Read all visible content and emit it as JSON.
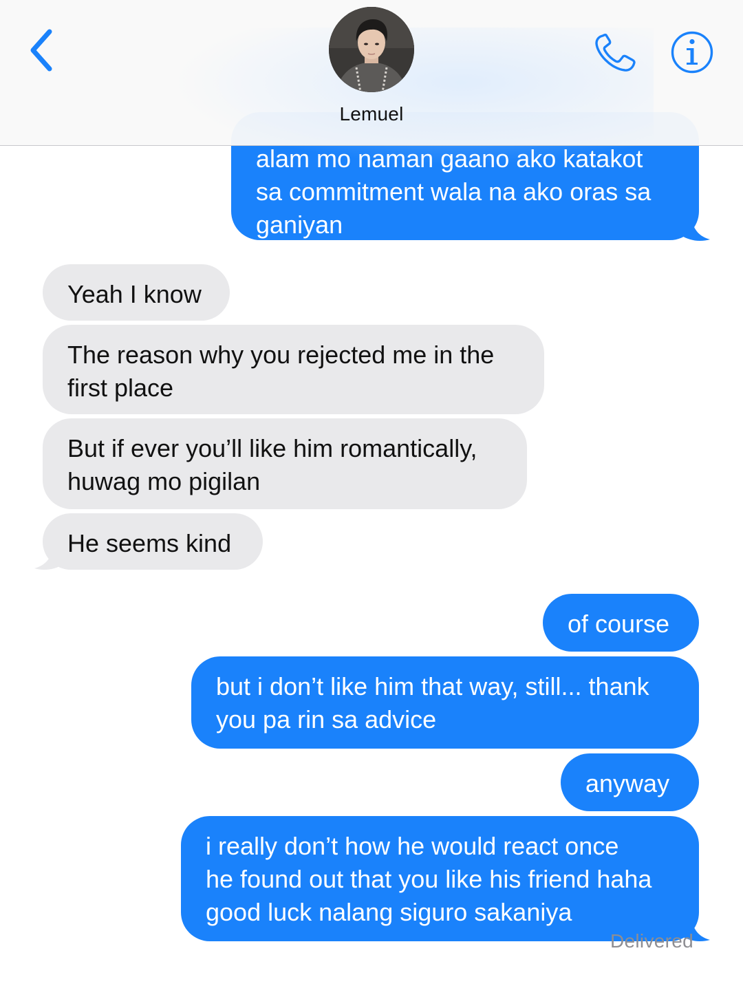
{
  "header": {
    "contact_name": "Lemuel",
    "back_icon": "chevron-left-icon",
    "call_icon": "phone-icon",
    "info_icon": "info-icon",
    "accent_color": "#1a82fb"
  },
  "messages": [
    {
      "from": "me",
      "text": "alam mo naman gaano ako katakot\nsa commitment wala na ako oras sa\nganiyan"
    },
    {
      "from": "them",
      "text": "Yeah I know"
    },
    {
      "from": "them",
      "text": "The reason why you rejected me in the\nfirst place"
    },
    {
      "from": "them",
      "text": "But if ever you’ll like him romantically,\nhuwag mo pigilan"
    },
    {
      "from": "them",
      "text": "He seems kind"
    },
    {
      "from": "me",
      "text": "of course"
    },
    {
      "from": "me",
      "text": "but i don’t like him that way, still... thank\nyou pa rin sa advice"
    },
    {
      "from": "me",
      "text": "anyway"
    },
    {
      "from": "me",
      "text": "i really don’t how he would react once\nhe found out that you like his friend haha\ngood luck nalang siguro sakaniya"
    }
  ],
  "status": {
    "delivered_label": "Delivered"
  },
  "colors": {
    "sent_bubble": "#1a82fb",
    "received_bubble": "#e9e9eb"
  }
}
